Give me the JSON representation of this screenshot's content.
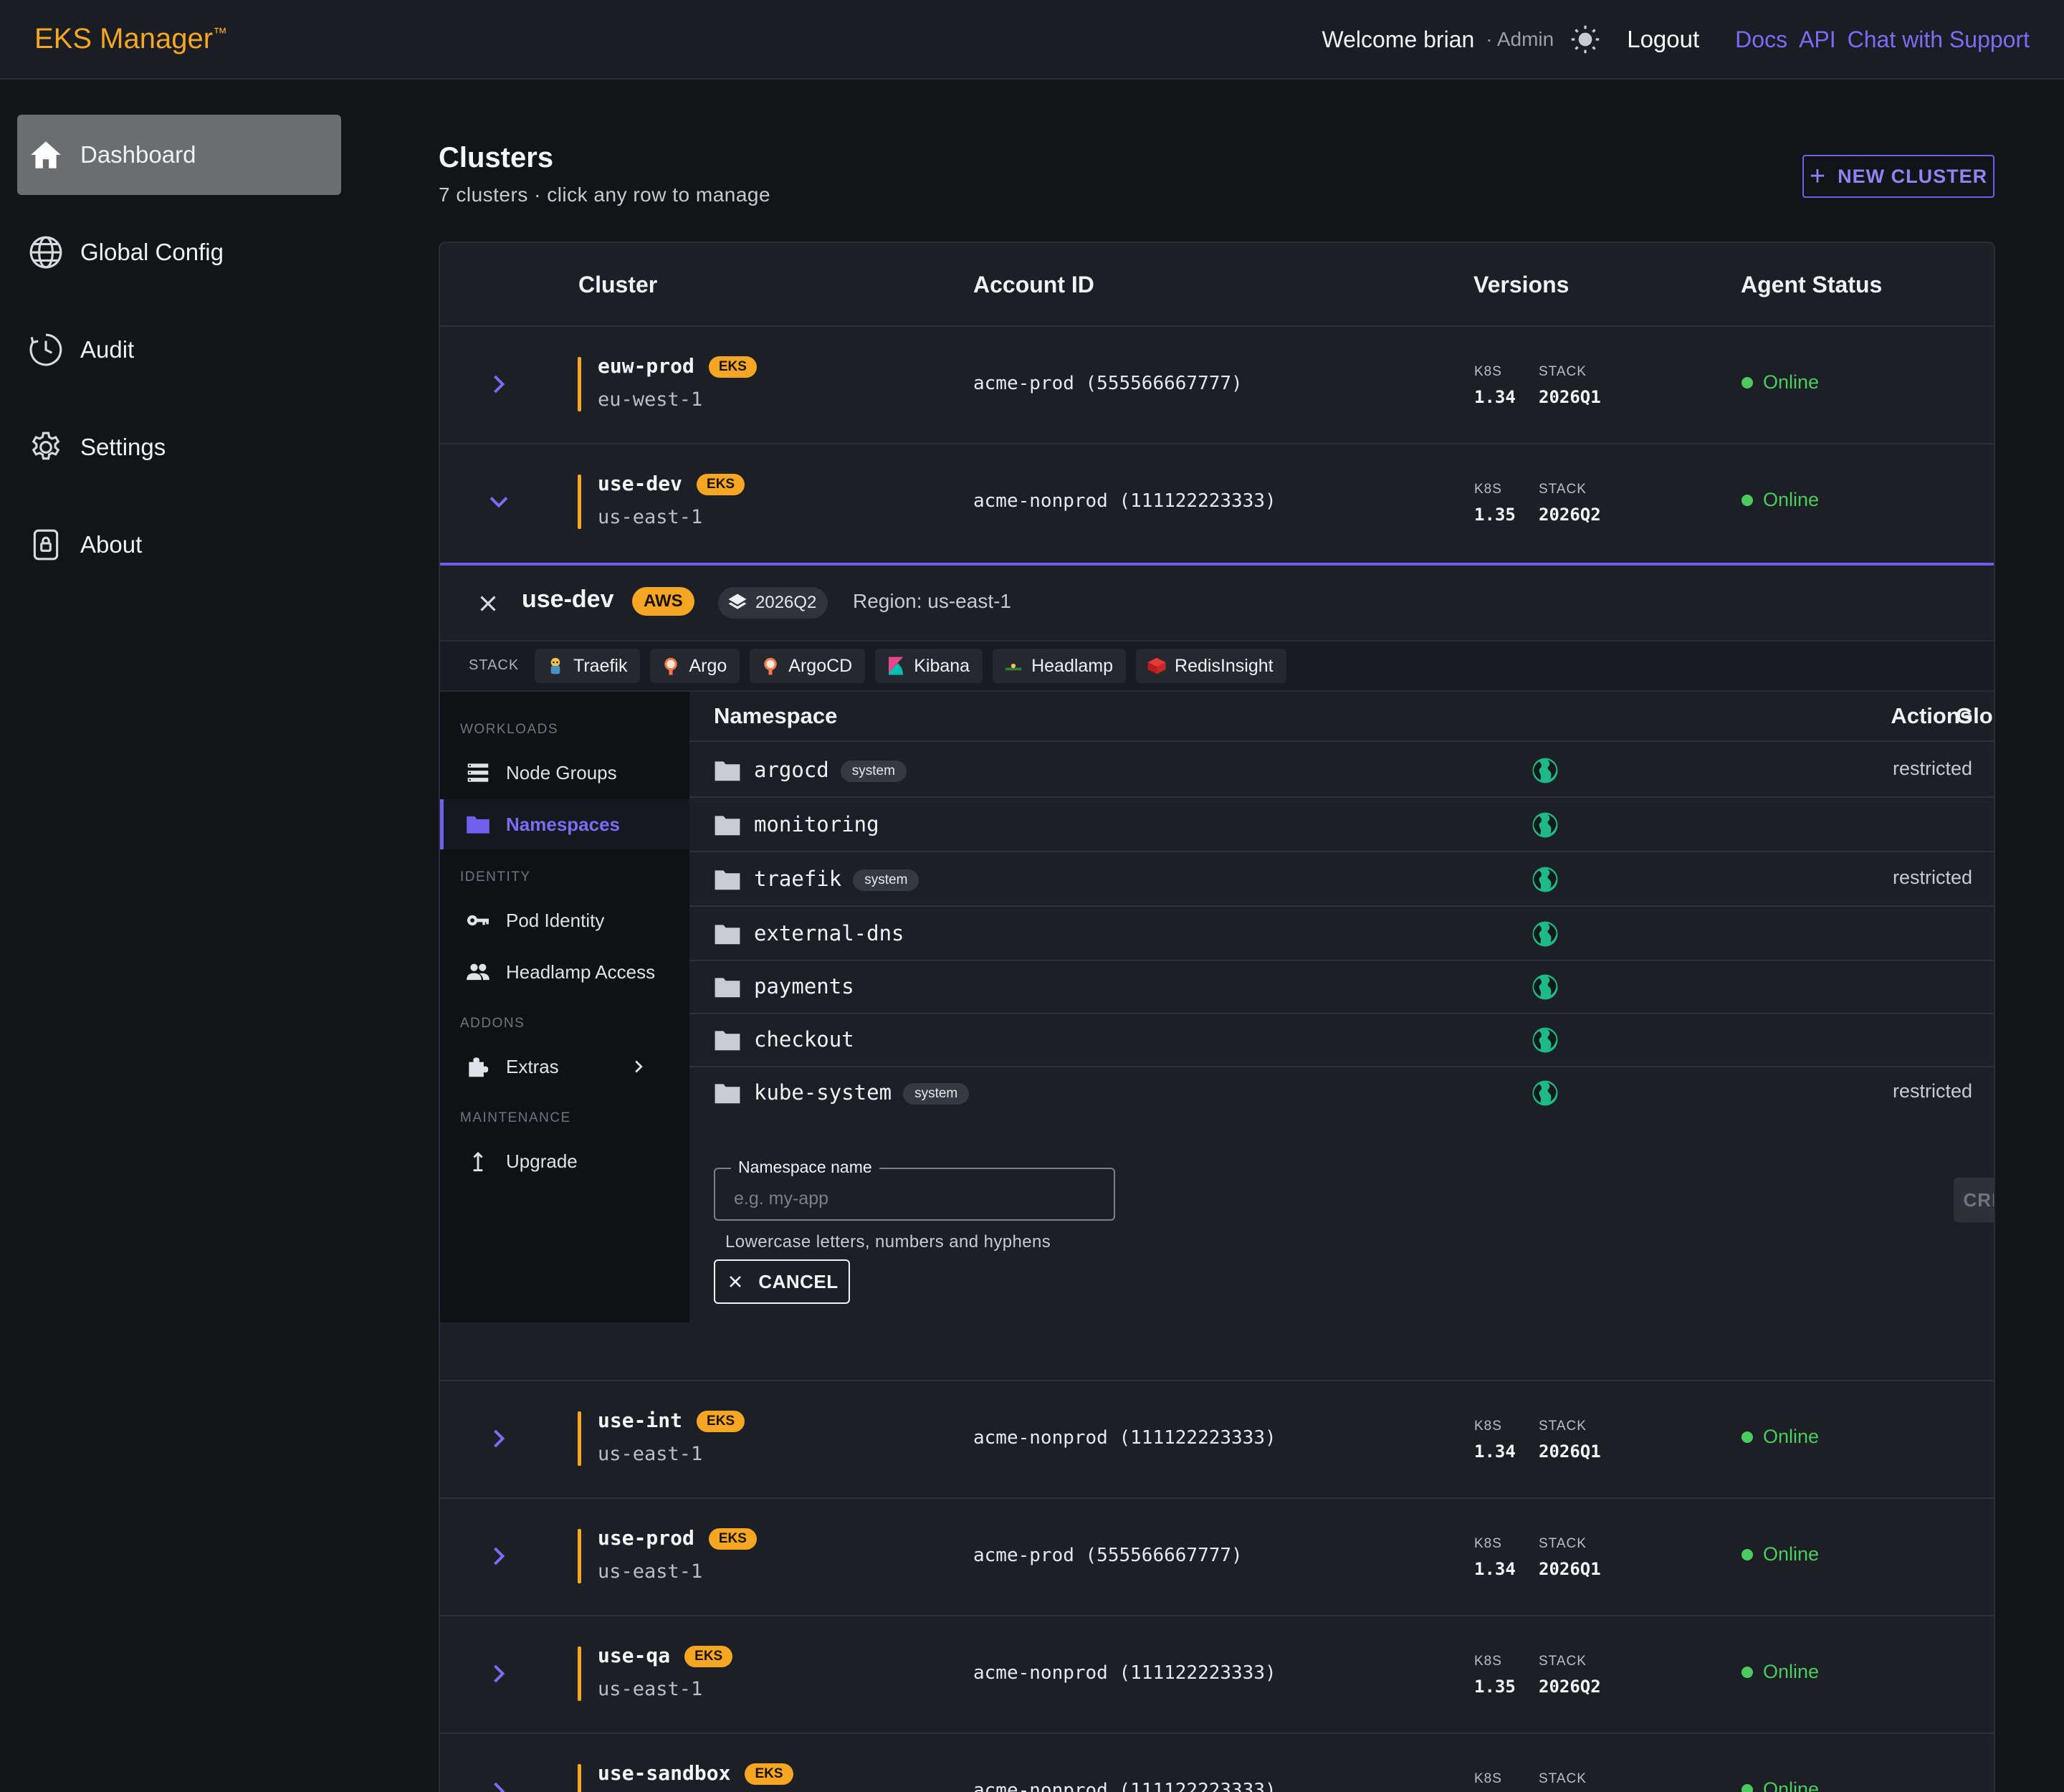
{
  "app": {
    "brand": "EKS Manager",
    "brand_mark": "™"
  },
  "topbar": {
    "welcome": "Welcome brian",
    "role": "· Admin",
    "theme_icon": "sun-icon",
    "logout": "Logout",
    "links": [
      "Docs",
      "API",
      "Chat with Support"
    ]
  },
  "sidebar": {
    "items": [
      {
        "label": "Dashboard",
        "icon": "home-icon",
        "active": true
      },
      {
        "label": "Global Config",
        "icon": "globe-icon"
      },
      {
        "label": "Audit",
        "icon": "clock-icon"
      },
      {
        "label": "Settings",
        "icon": "gear-icon"
      },
      {
        "label": "About",
        "icon": "lock-icon"
      }
    ]
  },
  "page": {
    "title": "Clusters",
    "subtitle": "7 clusters · click any row to manage",
    "new_cluster": "NEW CLUSTER"
  },
  "table": {
    "headers": {
      "cluster": "Cluster",
      "account": "Account ID",
      "versions": "Versions",
      "status": "Agent Status"
    },
    "k8s_label": "K8S",
    "stack_label": "STACK",
    "rows": [
      {
        "name": "euw-prod",
        "badge": "EKS",
        "region": "eu-west-1",
        "account": "acme-prod (555566667777)",
        "k8s": "1.34",
        "stack": "2026Q1",
        "status": "Online"
      },
      {
        "name": "use-dev",
        "badge": "EKS",
        "region": "us-east-1",
        "account": "acme-nonprod (111122223333)",
        "k8s": "1.35",
        "stack": "2026Q2",
        "status": "Online",
        "expanded": true
      },
      {
        "name": "use-int",
        "badge": "EKS",
        "region": "us-east-1",
        "account": "acme-nonprod (111122223333)",
        "k8s": "1.34",
        "stack": "2026Q1",
        "status": "Online"
      },
      {
        "name": "use-prod",
        "badge": "EKS",
        "region": "us-east-1",
        "account": "acme-prod (555566667777)",
        "k8s": "1.34",
        "stack": "2026Q1",
        "status": "Online"
      },
      {
        "name": "use-qa",
        "badge": "EKS",
        "region": "us-east-1",
        "account": "acme-nonprod (111122223333)",
        "k8s": "1.35",
        "stack": "2026Q2",
        "status": "Online"
      },
      {
        "name": "use-sandbox",
        "badge": "EKS",
        "region": "",
        "account": "acme-nonprod (111122223333)",
        "k8s": "",
        "stack": "",
        "status": "Online"
      }
    ]
  },
  "detail": {
    "name": "use-dev",
    "provider_badge": "AWS",
    "stack_version": "2026Q2",
    "region": "Region: us-east-1",
    "stack_label": "STACK",
    "tools": [
      {
        "label": "Traefik",
        "icon": "traefik-icon"
      },
      {
        "label": "Argo",
        "icon": "argo-icon"
      },
      {
        "label": "ArgoCD",
        "icon": "argocd-icon"
      },
      {
        "label": "Kibana",
        "icon": "kibana-icon"
      },
      {
        "label": "Headlamp",
        "icon": "headlamp-icon"
      },
      {
        "label": "RedisInsight",
        "icon": "redis-icon"
      }
    ],
    "nav": {
      "workloads": "WORKLOADS",
      "node_groups": "Node Groups",
      "namespaces": "Namespaces",
      "identity": "IDENTITY",
      "pod_identity": "Pod Identity",
      "headlamp_access": "Headlamp Access",
      "addons": "ADDONS",
      "extras": "Extras",
      "maintenance": "MAINTENANCE",
      "upgrade": "Upgrade"
    },
    "ns_headers": {
      "namespace": "Namespace",
      "global": "Global",
      "actions": "Actions"
    },
    "namespaces": [
      {
        "name": "argocd",
        "system": "system",
        "action": "restricted"
      },
      {
        "name": "monitoring",
        "system": "",
        "action": ""
      },
      {
        "name": "traefik",
        "system": "system",
        "action": "restricted"
      },
      {
        "name": "external-dns",
        "system": "",
        "action": ""
      },
      {
        "name": "payments",
        "system": "",
        "action": ""
      },
      {
        "name": "checkout",
        "system": "",
        "action": ""
      },
      {
        "name": "kube-system",
        "system": "system",
        "action": "restricted"
      }
    ],
    "form": {
      "label": "Namespace name",
      "placeholder": "e.g. my-app",
      "value": "",
      "helper": "Lowercase letters, numbers and hyphens",
      "create": "CREATE",
      "cancel": "CANCEL"
    }
  },
  "colors": {
    "accent": "#6f5fef",
    "brand": "#f5a623",
    "online": "#4ccb5e",
    "globe": "#1fb889"
  }
}
